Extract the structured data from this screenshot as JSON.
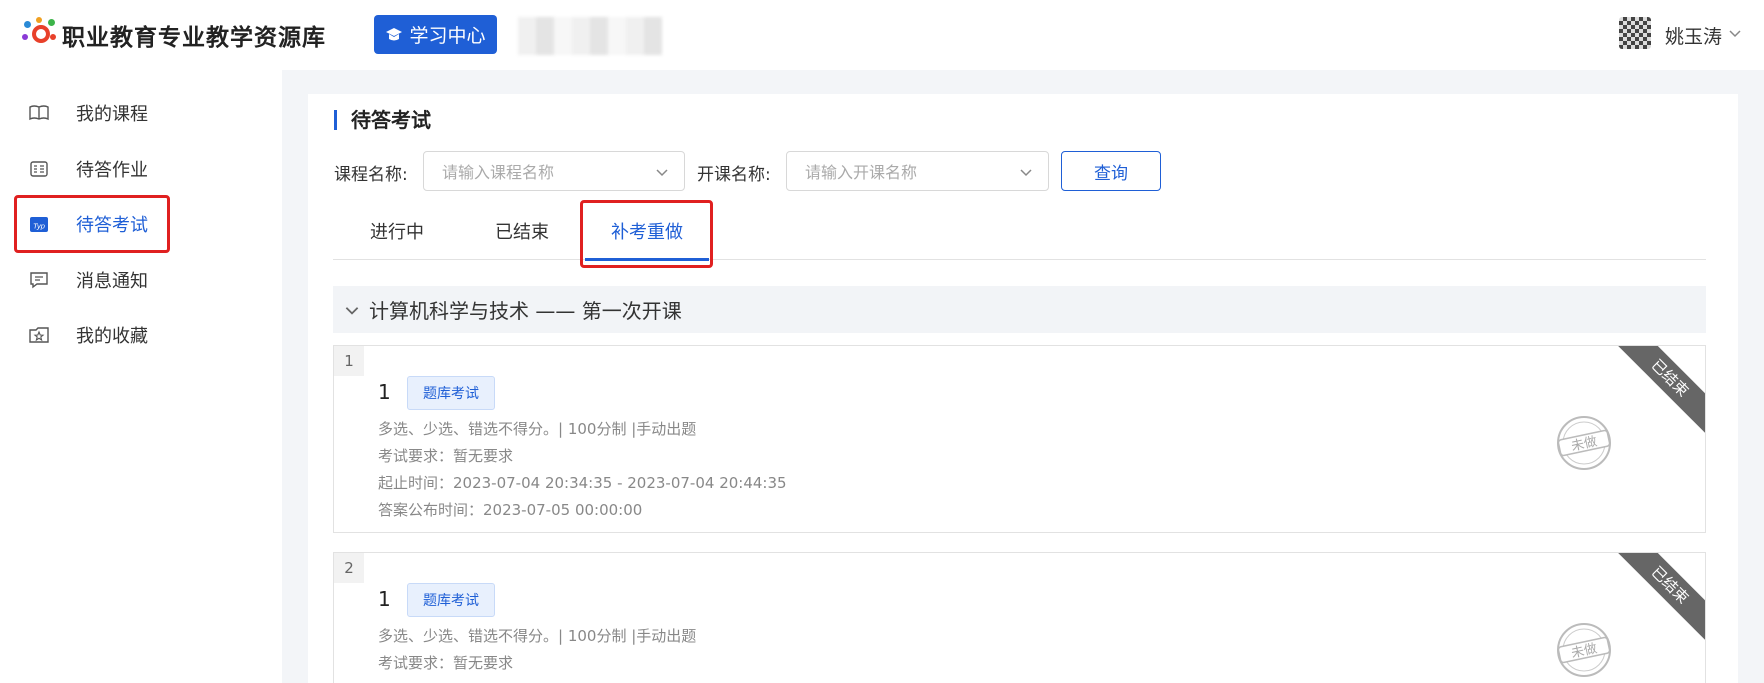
{
  "header": {
    "site_title": "职业教育专业教学资源库",
    "learning_center": "学习中心",
    "user_name": "姚玉涛"
  },
  "sidebar": {
    "items": [
      {
        "label": "我的课程",
        "icon": "book-icon"
      },
      {
        "label": "待答作业",
        "icon": "homework-icon"
      },
      {
        "label": "待答考试",
        "icon": "exam-icon",
        "active": true
      },
      {
        "label": "消息通知",
        "icon": "message-icon"
      },
      {
        "label": "我的收藏",
        "icon": "favorite-icon"
      }
    ]
  },
  "main": {
    "section_title": "待答考试",
    "filters": {
      "course_label": "课程名称:",
      "course_placeholder": "请输入课程名称",
      "class_label": "开课名称:",
      "class_placeholder": "请输入开课名称",
      "query_button": "查询"
    },
    "tabs": [
      {
        "label": "进行中"
      },
      {
        "label": "已结束"
      },
      {
        "label": "补考重做",
        "active": true
      }
    ],
    "group_title": "计算机科学与技术 —— 第一次开课",
    "exams": [
      {
        "index": "1",
        "number": "1",
        "tag": "题库考试",
        "rules": "多选、少选、错选不得分。| 100分制 |手动出题",
        "requirement": "考试要求：暂无要求",
        "time_range": "起止时间：2023-07-04 20:34:35 - 2023-07-04 20:44:35",
        "answer_time": "答案公布时间：2023-07-05 00:00:00",
        "ribbon": "已结束",
        "stamp": "未做"
      },
      {
        "index": "2",
        "number": "1",
        "tag": "题库考试",
        "rules": "多选、少选、错选不得分。| 100分制 |手动出题",
        "requirement": "考试要求：暂无要求",
        "time_range": "",
        "answer_time": "",
        "ribbon": "已结束",
        "stamp": "未做"
      }
    ]
  },
  "colors": {
    "accent": "#1f5fd6",
    "highlight_border": "#e02020",
    "ribbon": "#666666"
  }
}
